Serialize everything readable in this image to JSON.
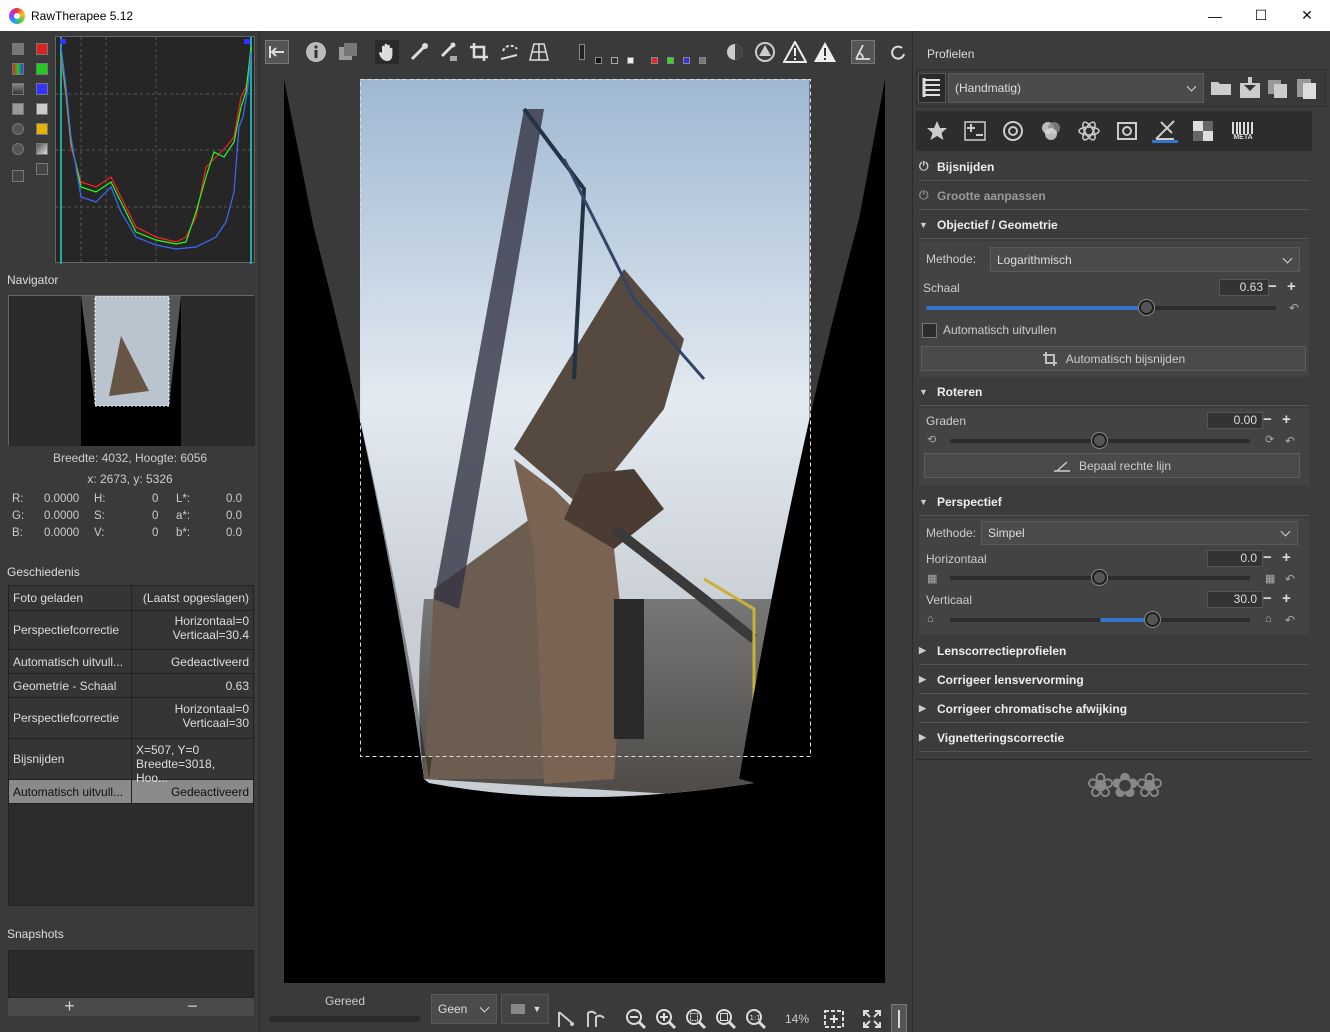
{
  "window": {
    "title": "RawTherapee 5.12",
    "minimize": "—",
    "maximize": "☐",
    "close": "✕"
  },
  "histogram": {
    "series_colors": [
      "#ff0000",
      "#00ff00",
      "#3030ff"
    ]
  },
  "navigator": {
    "title": "Navigator",
    "dims": "Breedte: 4032, Hoogte: 6056",
    "coords": "x: 2673, y: 5326",
    "values": {
      "r_label": "R:",
      "r": "0.0000",
      "g_label": "G:",
      "g": "0.0000",
      "b_label": "B:",
      "b": "0.0000",
      "h_label": "H:",
      "h": "0",
      "s_label": "S:",
      "s": "0",
      "v_label": "V:",
      "v": "0",
      "l_label": "L*:",
      "l": "0.0",
      "a_label": "a*:",
      "a": "0.0",
      "bb_label": "b*:",
      "bb": "0.0"
    }
  },
  "history": {
    "title": "Geschiedenis",
    "rows": [
      {
        "action": "Foto geladen",
        "value1": "(Laatst opgeslagen)",
        "value2": ""
      },
      {
        "action": "Perspectiefcorrectie",
        "value1": "Horizontaal=0",
        "value2": "Verticaal=30.4"
      },
      {
        "action": "Automatisch uitvull...",
        "value1": "Gedeactiveerd",
        "value2": ""
      },
      {
        "action": "Geometrie - Schaal",
        "value1": "0.63",
        "value2": ""
      },
      {
        "action": "Perspectiefcorrectie",
        "value1": "Horizontaal=0",
        "value2": "Verticaal=30"
      },
      {
        "action": "Bijsnijden",
        "value1": "X=507, Y=0",
        "value2": "Breedte=3018, Hoo..."
      },
      {
        "action": "Automatisch uitvull...",
        "value1": "Gedeactiveerd",
        "value2": ""
      }
    ]
  },
  "snapshots": {
    "title": "Snapshots",
    "add": "+",
    "remove": "−"
  },
  "statusbar": {
    "status": "Gereed",
    "mode_select": "Geen",
    "zoom": "14%"
  },
  "profiles": {
    "title": "Profielen",
    "selected": "(Handmatig)"
  },
  "tabs": {
    "meta": "META"
  },
  "tools": {
    "crop": "Bijsnijden",
    "resize": "Grootte aanpassen",
    "lens_geometry": {
      "title": "Objectief / Geometrie",
      "method_label": "Methode:",
      "method_value": "Logarithmisch",
      "scale_label": "Schaal",
      "scale_value": "0.63",
      "scale_fraction": 0.63,
      "autofill_label": "Automatisch uitvullen",
      "autofill_checked": false,
      "autocrop_button": "Automatisch bijsnijden"
    },
    "rotate": {
      "title": "Roteren",
      "degree_label": "Graden",
      "degree_value": "0.00",
      "degree_fraction": 0.5,
      "straighten_button": "Bepaal rechte lijn"
    },
    "perspective": {
      "title": "Perspectief",
      "method_label": "Methode:",
      "method_value": "Simpel",
      "horizontal_label": "Horizontaal",
      "horizontal_value": "0.0",
      "horizontal_fraction": 0.5,
      "vertical_label": "Verticaal",
      "vertical_value": "30.0",
      "vertical_fraction": 0.675
    },
    "collapsed": [
      "Lenscorrectieprofielen",
      "Corrigeer lensvervorming",
      "Corrigeer chromatische afwijking",
      "Vignetteringscorrectie"
    ]
  },
  "ornament": "❀✿❀"
}
